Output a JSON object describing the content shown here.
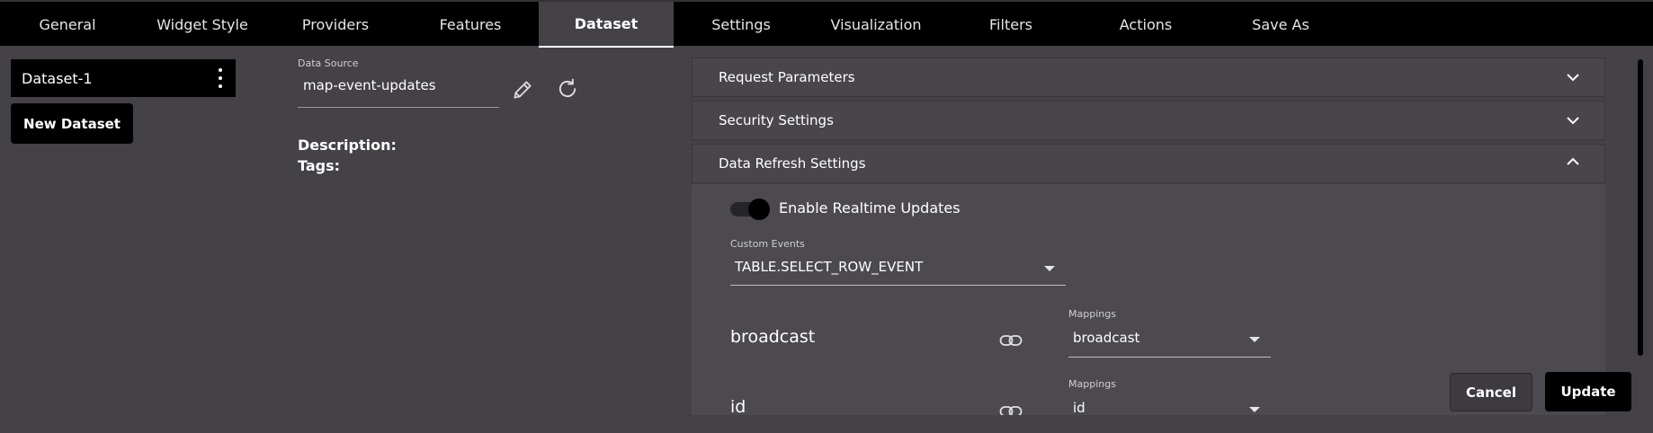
{
  "tabs": [
    {
      "label": "General",
      "active": false
    },
    {
      "label": "Widget Style",
      "active": false
    },
    {
      "label": "Providers",
      "active": false
    },
    {
      "label": "Features",
      "active": false
    },
    {
      "label": "Dataset",
      "active": true
    },
    {
      "label": "Settings",
      "active": false
    },
    {
      "label": "Visualization",
      "active": false
    },
    {
      "label": "Filters",
      "active": false
    },
    {
      "label": "Actions",
      "active": false
    },
    {
      "label": "Save As",
      "active": false
    }
  ],
  "datasets": {
    "items": [
      {
        "label": "Dataset-1"
      }
    ],
    "new_button": "New Dataset"
  },
  "data_source": {
    "label": "Data Source",
    "value": "map-event-updates",
    "description_label": "Description:",
    "tags_label": "Tags:"
  },
  "sections": {
    "request_parameters": "Request Parameters",
    "security_settings": "Security Settings",
    "data_refresh_settings": "Data Refresh Settings"
  },
  "refresh": {
    "realtime_label": "Enable Realtime Updates",
    "realtime_enabled": true,
    "custom_events_label": "Custom Events",
    "custom_events_value": "TABLE.SELECT_ROW_EVENT",
    "mappings": [
      {
        "field": "broadcast",
        "label": "Mappings",
        "value": "broadcast"
      },
      {
        "field": "id",
        "label": "Mappings",
        "value": "id"
      }
    ]
  },
  "actions": {
    "cancel": "Cancel",
    "update": "Update"
  },
  "colors": {
    "background": "#444147",
    "tabbar": "#000000",
    "accent": "#000000"
  }
}
